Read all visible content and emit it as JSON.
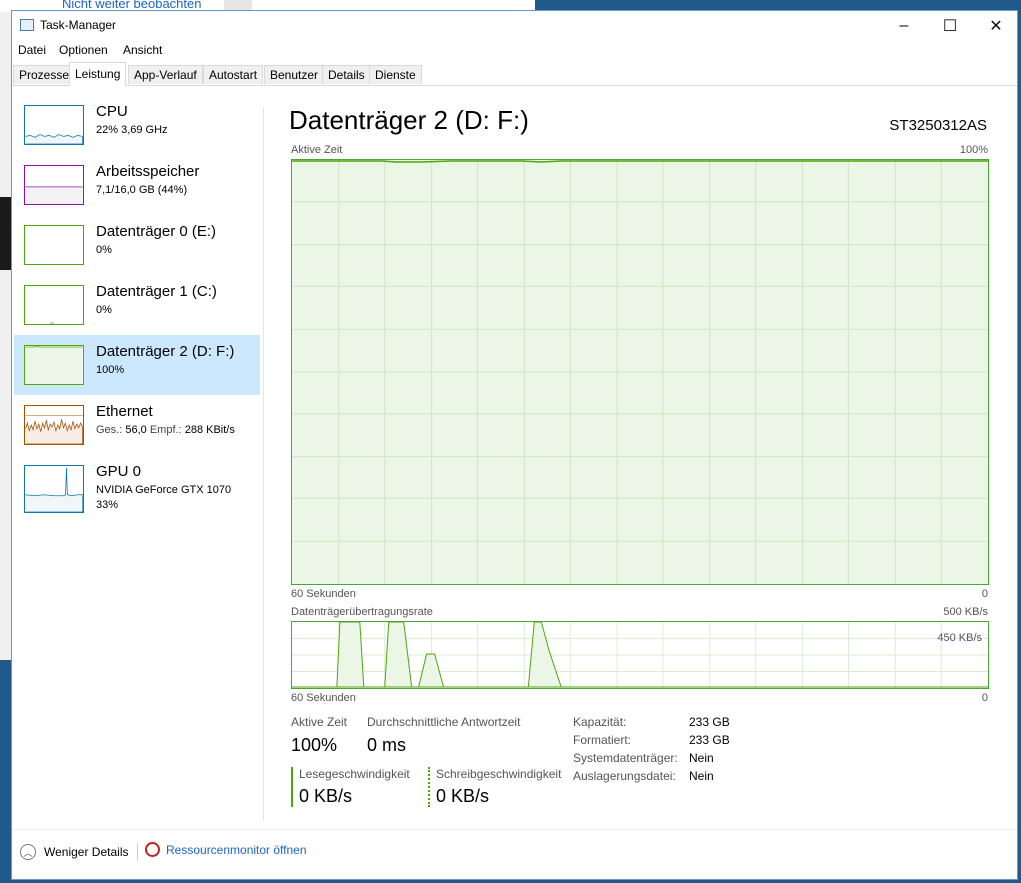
{
  "background_window": {
    "link_text": "Nicht weiter beobachten"
  },
  "window": {
    "title": "Task-Manager",
    "controls": [
      "–",
      "☐",
      "✕"
    ]
  },
  "menu": [
    "Datei",
    "Optionen",
    "Ansicht"
  ],
  "tabs": [
    "Prozesse",
    "Leistung",
    "App-Verlauf",
    "Autostart",
    "Benutzer",
    "Details",
    "Dienste"
  ],
  "active_tab": "Leistung",
  "sidebar": {
    "items": [
      {
        "title": "CPU",
        "sub1": "22% 3,69 GHz",
        "sub2": "",
        "sub3": "",
        "color": "#1176ae"
      },
      {
        "title": "Arbeitsspeicher",
        "sub1": "7,1/16,0 GB (44%)",
        "sub2": "",
        "sub3": "",
        "color": "#8b12ae"
      },
      {
        "title": "Datenträger 0 (E:)",
        "sub1": "0%",
        "sub2": "",
        "sub3": "",
        "color": "#4da60c"
      },
      {
        "title": "Datenträger 1 (C:)",
        "sub1": "0%",
        "sub2": "",
        "sub3": "",
        "color": "#4da60c"
      },
      {
        "title": "Datenträger 2 (D: F:)",
        "sub1": "100%",
        "sub2": "",
        "sub3": "",
        "color": "#4da60c"
      },
      {
        "title": "Ethernet",
        "sub1": "",
        "sub2": "",
        "sub3": "",
        "color": "#a74f01"
      },
      {
        "title": "GPU 0",
        "sub1": "NVIDIA GeForce GTX 1070",
        "sub2": "33%",
        "sub3": "",
        "color": "#1176ae"
      }
    ],
    "ethernet": {
      "send_label": "Ges.:",
      "send_value": "56,0",
      "recv_label": "Empf.:",
      "recv_value": "288 KBit/s"
    },
    "selected_index": 4
  },
  "main": {
    "title": "Datenträger 2 (D: F:)",
    "model": "ST3250312AS",
    "active_time_graph": {
      "label": "Aktive Zeit",
      "max_label": "100%",
      "x_left": "60 Sekunden",
      "x_right": "0",
      "value_percent": 100
    },
    "transfer_graph": {
      "label": "Datenträgerübertragungsrate",
      "max_label": "500 KB/s",
      "inner_label": "450 KB/s",
      "x_left": "60 Sekunden",
      "x_right": "0"
    },
    "stats": {
      "active_time_label": "Aktive Zeit",
      "active_time_value": "100%",
      "avg_response_label": "Durchschnittliche Antwortzeit",
      "avg_response_value": "0 ms",
      "read_label": "Lesegeschwindigkeit",
      "read_value": "0 KB/s",
      "write_label": "Schreibgeschwindigkeit",
      "write_value": "0 KB/s"
    },
    "properties": [
      {
        "label": "Kapazität:",
        "value": "233 GB"
      },
      {
        "label": "Formatiert:",
        "value": "233 GB"
      },
      {
        "label": "Systemdatenträger:",
        "value": "Nein"
      },
      {
        "label": "Auslagerungsdatei:",
        "value": "Nein"
      }
    ]
  },
  "footer": {
    "fewer_details": "Weniger Details",
    "resource_monitor": "Ressourcenmonitor öffnen"
  }
}
